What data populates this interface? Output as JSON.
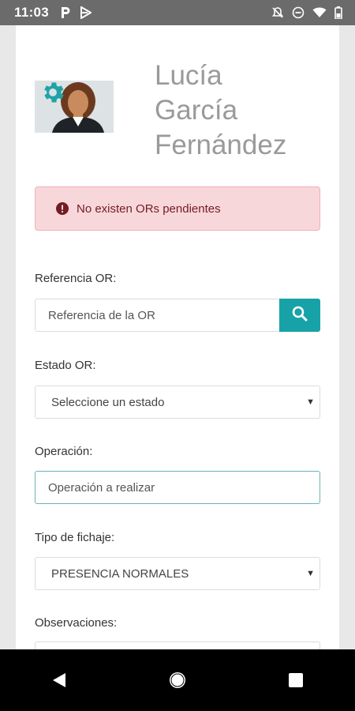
{
  "status_bar": {
    "time": "11:03",
    "left_icons": [
      "parking-icon",
      "play-store-icon"
    ],
    "right_icons": [
      "notifications-off-icon",
      "do-not-disturb-icon",
      "wifi-icon",
      "battery-icon"
    ]
  },
  "profile": {
    "name_line1": "Lucía",
    "name_line2": "García",
    "name_line3": "Fernández"
  },
  "alert": {
    "message": "No existen ORs pendientes"
  },
  "form": {
    "referencia_label": "Referencia OR:",
    "referencia_placeholder": "Referencia de la OR",
    "estado_label": "Estado OR:",
    "estado_value": "Seleccione un estado",
    "operacion_label": "Operación:",
    "operacion_placeholder": "Operación a realizar",
    "tipo_label": "Tipo de fichaje:",
    "tipo_value": "PRESENCIA NORMALES",
    "observaciones_label": "Observaciones:"
  },
  "colors": {
    "accent": "#17a2a8",
    "alert_bg": "#f8d7da",
    "alert_text": "#721c24"
  }
}
